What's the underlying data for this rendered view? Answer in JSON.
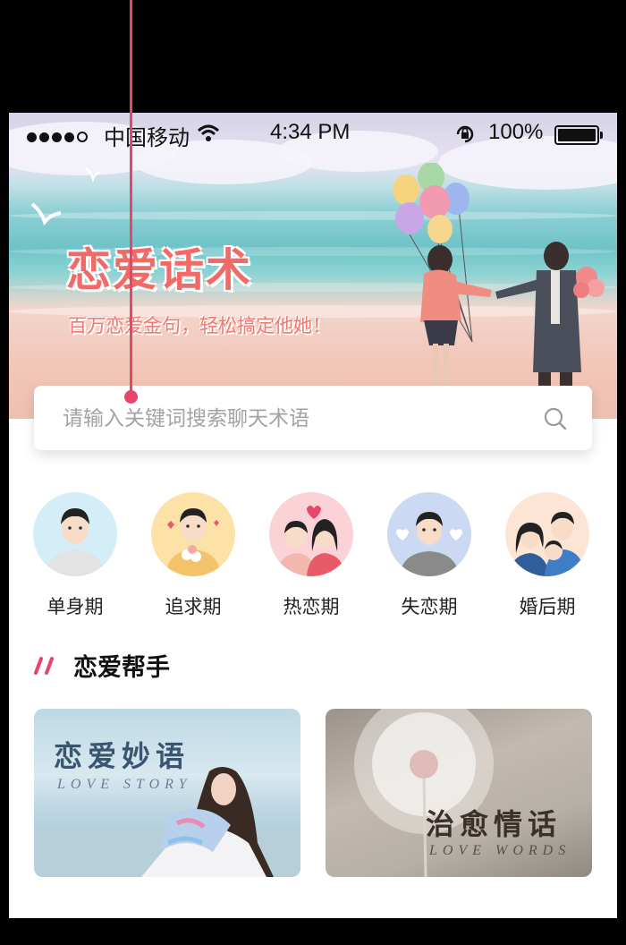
{
  "status_bar": {
    "carrier": "中国移动",
    "time": "4:34 PM",
    "battery": "100%"
  },
  "banner": {
    "title": "恋爱话术",
    "subtitle": "百万恋爱金句，轻松搞定他她！"
  },
  "search": {
    "placeholder": "请输入关键词搜索聊天术语"
  },
  "categories": [
    {
      "label": "单身期"
    },
    {
      "label": "追求期"
    },
    {
      "label": "热恋期"
    },
    {
      "label": "失恋期"
    },
    {
      "label": "婚后期"
    }
  ],
  "section": {
    "title": "恋爱帮手"
  },
  "cards": [
    {
      "title": "恋爱妙语",
      "subtitle": "LOVE STORY"
    },
    {
      "title": "治愈情话",
      "subtitle": "LOVE WORDS"
    }
  ],
  "colors": {
    "accent": "#e8456a",
    "banner_title": "#f06b67"
  }
}
